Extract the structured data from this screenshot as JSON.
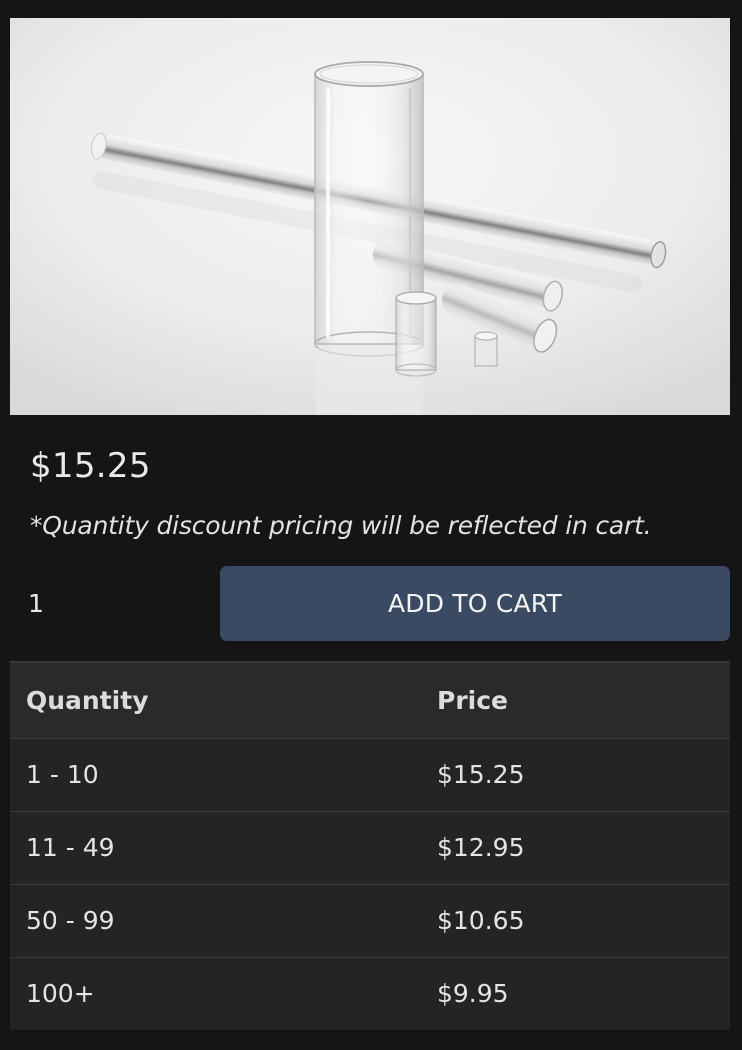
{
  "product": {
    "image_alt": "Clear acrylic tubes",
    "price": "$15.25",
    "discount_note": "*Quantity discount pricing will be reflected in cart."
  },
  "cart": {
    "quantity_value": "1",
    "add_to_cart_label": "ADD TO CART",
    "button_color": "#3a4a62"
  },
  "pricing_table": {
    "headers": [
      "Quantity",
      "Price"
    ],
    "rows": [
      [
        "1 - 10",
        "$15.25"
      ],
      [
        "11 - 49",
        "$12.95"
      ],
      [
        "50 - 99",
        "$10.65"
      ],
      [
        "100+",
        "$9.95"
      ]
    ]
  }
}
